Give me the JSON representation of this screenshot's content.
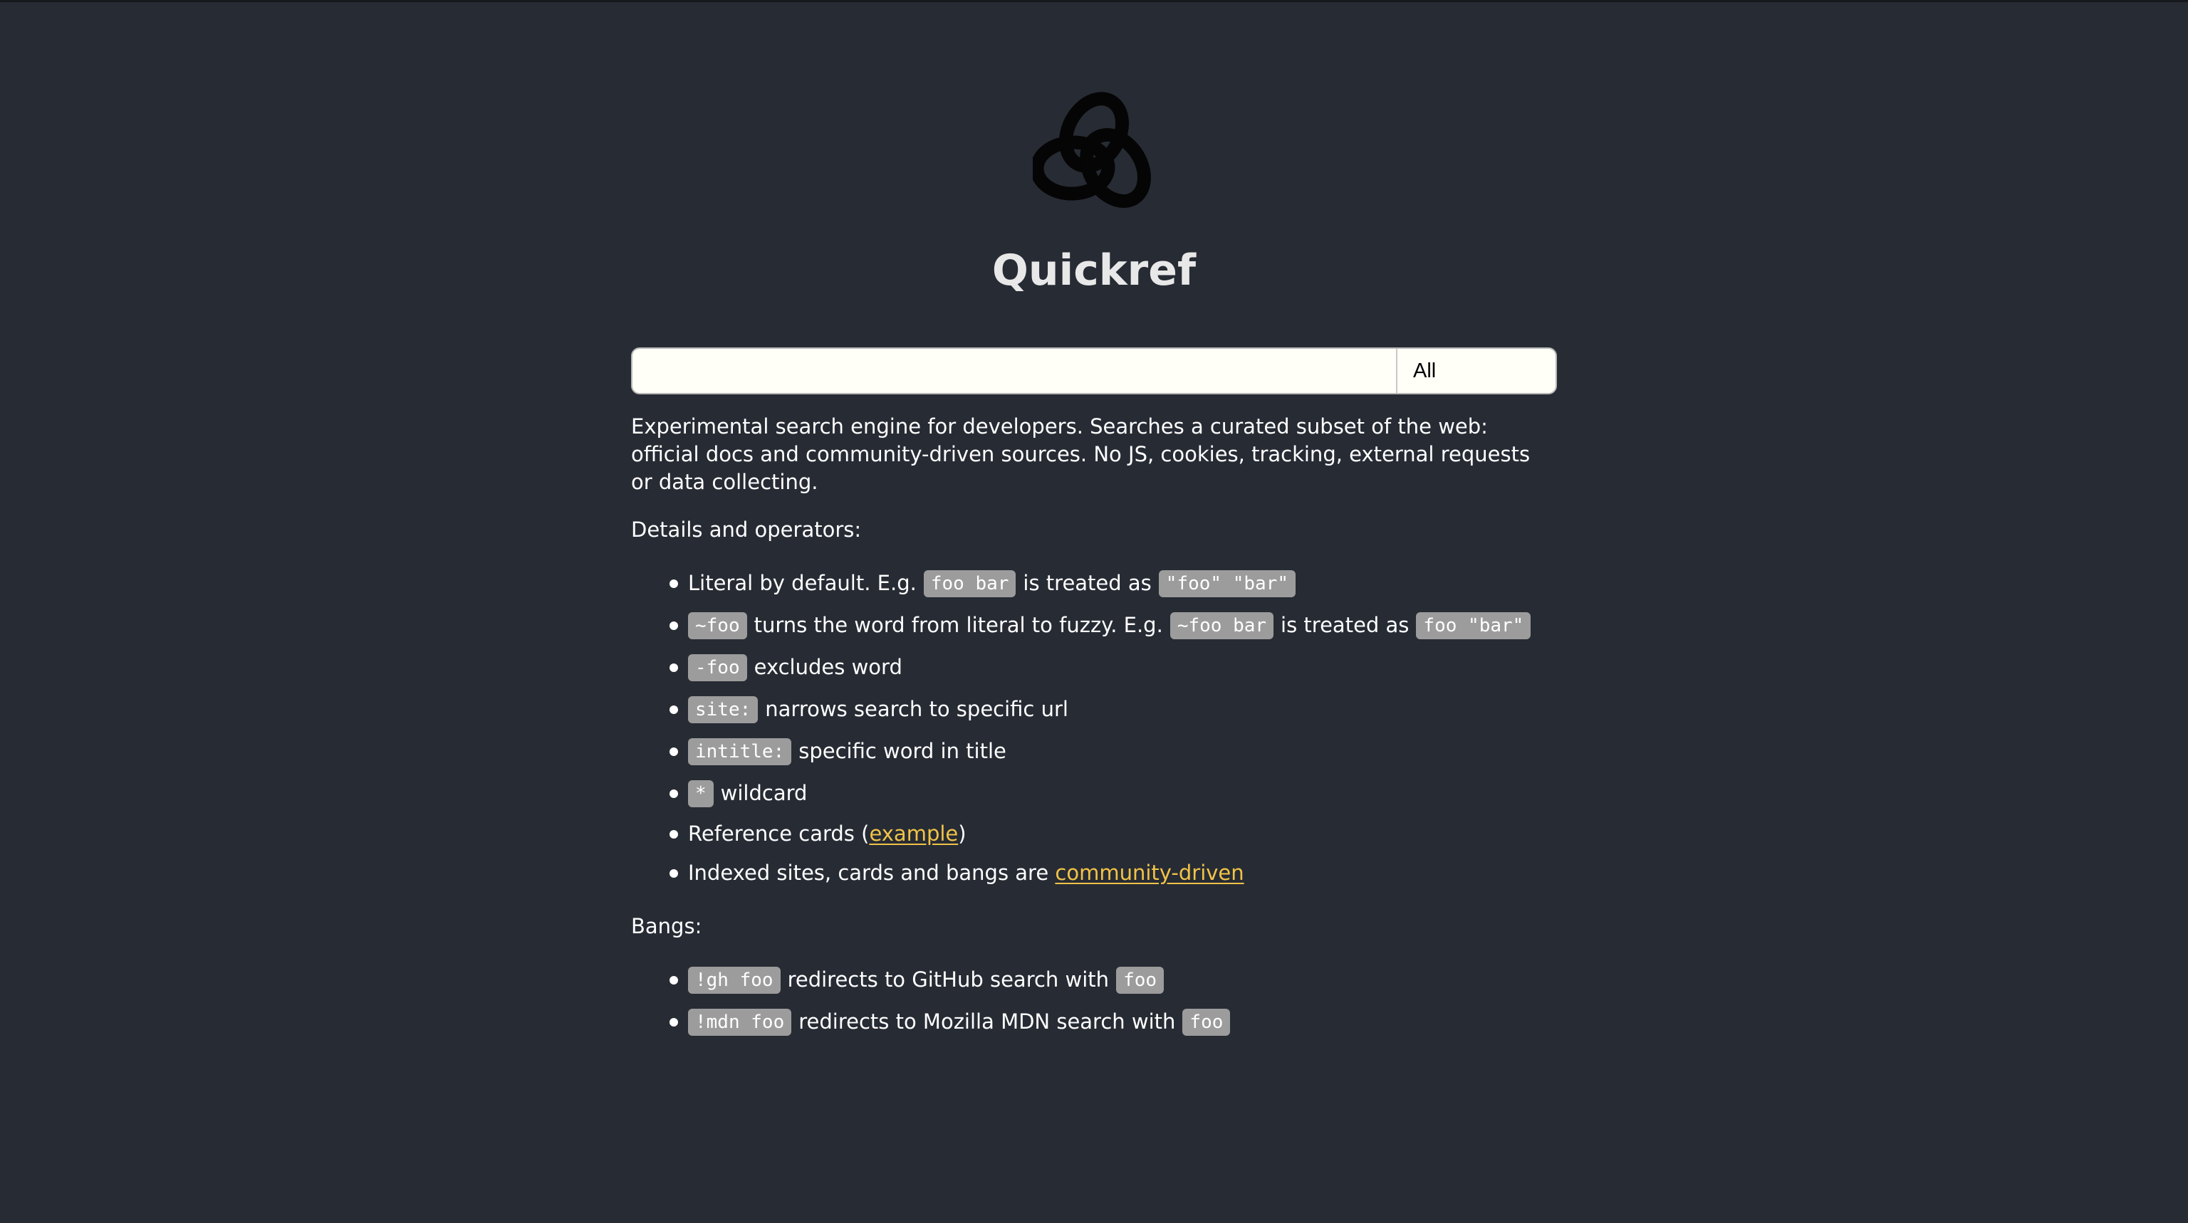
{
  "app": {
    "title": "Quickref"
  },
  "search": {
    "value": "",
    "placeholder": "",
    "scope": "All"
  },
  "intro": {
    "description": "Experimental search engine for developers. Searches a curated subset of the web: official docs and community-driven sources. No JS, cookies, tracking, external requests or data collecting."
  },
  "details": {
    "heading": "Details and operators:",
    "items": {
      "literal": {
        "text1": "Literal by default. E.g.",
        "code1": "foo bar",
        "text2": "is treated as",
        "code2": "\"foo\" \"bar\""
      },
      "fuzzy": {
        "code1": "~foo",
        "text1": "turns the word from literal to fuzzy. E.g.",
        "code2": "~foo bar",
        "text2": "is treated as",
        "code3": "foo \"bar\""
      },
      "exclude": {
        "code1": "-foo",
        "text1": "excludes word"
      },
      "site": {
        "code1": "site:",
        "text1": "narrows search to specific url"
      },
      "intitle": {
        "code1": "intitle:",
        "text1": "specific word in title"
      },
      "wildcard": {
        "code1": "*",
        "text1": "wildcard"
      },
      "cards": {
        "text1": "Reference cards (",
        "link": "example",
        "text2": ")"
      },
      "indexed": {
        "text1": "Indexed sites, cards and bangs are",
        "link": "community-driven"
      }
    }
  },
  "bangs": {
    "heading": "Bangs:",
    "items": {
      "gh": {
        "code1": "!gh foo",
        "text1": "redirects to GitHub search with",
        "code2": "foo"
      },
      "mdn": {
        "code1": "!mdn foo",
        "text1": "redirects to Mozilla MDN search with",
        "code2": "foo"
      }
    }
  },
  "colors": {
    "background": "#272b34",
    "link": "#f1c347",
    "code_background": "#9c9c9c"
  }
}
